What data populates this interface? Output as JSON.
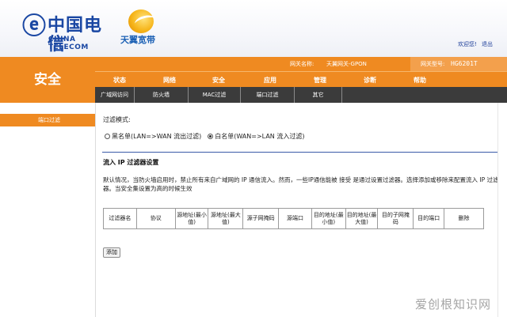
{
  "header": {
    "brand_cn": "中国电信",
    "brand_en": "CHINA TELECOM",
    "sub_brand": "天翼宽带",
    "links": [
      "欢迎您!",
      "退出"
    ]
  },
  "status": {
    "gateway_label": "网关名称:",
    "gateway_value": "天翼网关-GPON",
    "model_label": "网关型号:",
    "model_value": "HG6201T"
  },
  "section_title": "安全",
  "main_nav": [
    "状态",
    "网络",
    "安全",
    "应用",
    "管理",
    "诊断",
    "帮助"
  ],
  "sub_nav": [
    "广域网访问",
    "防火墙",
    "MAC过滤",
    "端口过滤",
    "其它"
  ],
  "left_menu": {
    "active": "端口过滤"
  },
  "content": {
    "filter_mode_label": "过滤模式:",
    "radio_blacklist": "黑名单(LAN=>WAN 流出过滤)",
    "radio_whitelist": "白名单(WAN=>LAN 流入过滤)",
    "section_heading": "流入 IP 过滤器设置",
    "description": "默认情况，当防火墙启用时，禁止所有来自广域网的 IP 通信流入。然而，一些IP通信能被 接受 是通过设置过滤器。选择添加或移除来配置流入 IP 过滤器。当安全集设置为高的时候生效",
    "table_headers": [
      "过滤器名",
      "协议",
      "源地址(最小值)",
      "源地址(最大值)",
      "源子网掩码",
      "源端口",
      "目的地址(最小值)",
      "目的地址(最大值)",
      "目的子网掩码",
      "目的端口",
      "删除"
    ],
    "add_button": "添加"
  },
  "watermark": "爱创根知识网",
  "colors": {
    "orange": "#ef8a21",
    "dark": "#3b3b3b",
    "blue": "#1a47a3"
  }
}
